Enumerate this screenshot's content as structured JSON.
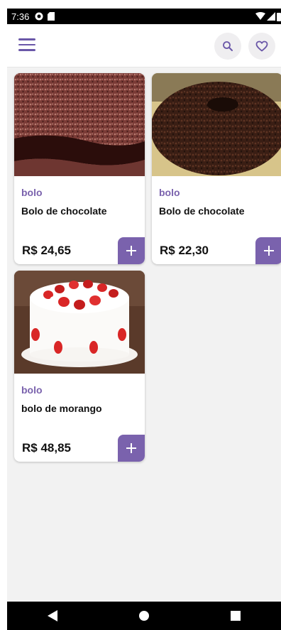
{
  "status_bar": {
    "time": "7:36"
  },
  "header": {
    "menu_icon": "hamburger-menu-icon",
    "search_icon": "search-icon",
    "favorite_icon": "heart-icon"
  },
  "products": [
    {
      "category": "bolo",
      "name": "Bolo de chocolate",
      "price": "R$ 24,65"
    },
    {
      "category": "bolo",
      "name": "Bolo de chocolate",
      "price": "R$ 22,30"
    },
    {
      "category": "bolo",
      "name": "bolo de morango",
      "price": "R$ 48,85"
    }
  ],
  "colors": {
    "accent": "#7a62ad",
    "background": "#f2f2f2",
    "card": "#ffffff"
  },
  "nav_bar": {
    "back_icon": "back-triangle-icon",
    "home_icon": "home-circle-icon",
    "recents_icon": "recents-square-icon"
  }
}
